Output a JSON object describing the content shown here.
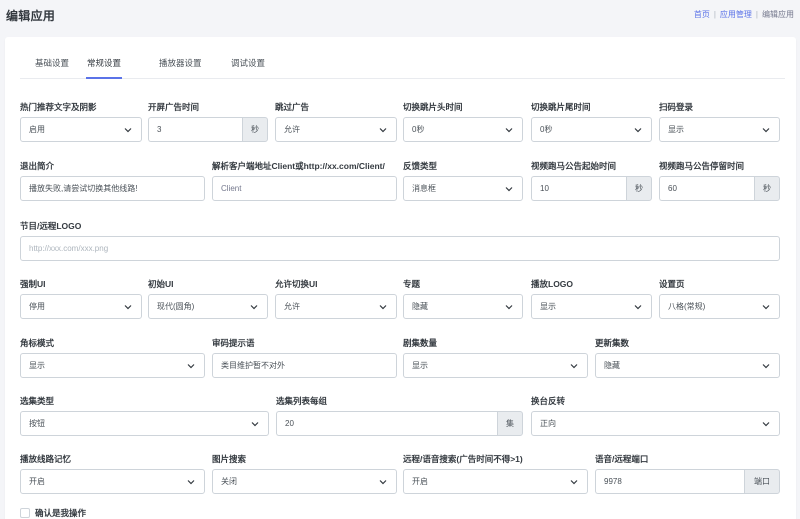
{
  "header": {
    "title": "编辑应用",
    "breadcrumb": [
      "首页",
      "应用管理",
      "编辑应用"
    ]
  },
  "tabs": [
    "基础设置",
    "常规设置",
    "播放器设置",
    "调试设置"
  ],
  "form": {
    "hot_text_shadow": {
      "label": "热门推荐文字及阴影",
      "value": "启用"
    },
    "ad_time": {
      "label": "开屏广告时间",
      "value": "3",
      "unit": "秒"
    },
    "skip_ad": {
      "label": "跳过广告",
      "value": "允许"
    },
    "intro_head": {
      "label": "切换跳片头时间",
      "value": "0秒"
    },
    "intro_tail": {
      "label": "切换跳片尾时间",
      "value": "0秒"
    },
    "scan_login": {
      "label": "扫码登录",
      "value": "显示"
    },
    "exit_intro": {
      "label": "退出简介",
      "value": "播放失败,请尝试切换其他线路!"
    },
    "client_parse": {
      "label": "解析客户端地址Client或http://xx.com/Client/",
      "value": "Client"
    },
    "feedback_type": {
      "label": "反馈类型",
      "value": "消息框"
    },
    "notice_start": {
      "label": "视频跑马公告起始时间",
      "value": "10",
      "unit": "秒"
    },
    "notice_stay": {
      "label": "视频跑马公告停留时间",
      "value": "60",
      "unit": "秒"
    },
    "logo": {
      "label": "节目/远程LOGO",
      "placeholder": "http://xxx.com/xxx.png"
    },
    "force_ui": {
      "label": "强制UI",
      "value": "停用"
    },
    "init_ui": {
      "label": "初始UI",
      "value": "现代(圆角)"
    },
    "switch_ui": {
      "label": "允许切换UI",
      "value": "允许"
    },
    "theme": {
      "label": "专题",
      "value": "隐藏"
    },
    "play_logo": {
      "label": "播放LOGO",
      "value": "显示"
    },
    "settings_page": {
      "label": "设置页",
      "value": "八格(常规)"
    },
    "corner_mode": {
      "label": "角标模式",
      "value": "显示"
    },
    "restrict_tip": {
      "label": "审码提示语",
      "value": "类目维护暂不对外"
    },
    "episode_count": {
      "label": "剧集数量",
      "value": "显示"
    },
    "update_count": {
      "label": "更新集数",
      "value": "隐藏"
    },
    "episode_type": {
      "label": "选集类型",
      "value": "按钮"
    },
    "episode_per_row": {
      "label": "选集列表每组",
      "value": "20",
      "unit": "集"
    },
    "channel_reverse": {
      "label": "换台反转",
      "value": "正向"
    },
    "play_memory": {
      "label": "播放线路记忆",
      "value": "开启"
    },
    "image_search": {
      "label": "图片搜索",
      "value": "关闭"
    },
    "remote_voice_search": {
      "label": "远程/语音搜索(广告时间不得>1)",
      "value": "开启"
    },
    "voice_port": {
      "label": "语音/远程端口",
      "value": "9978",
      "unit": "端口"
    }
  },
  "confirm": {
    "label": "确认是我操作"
  },
  "colors": {
    "accent": "#5b73e8",
    "border": "#ced4da",
    "addon_bg": "#e9ecef",
    "page_bg": "#f4f5f8"
  }
}
